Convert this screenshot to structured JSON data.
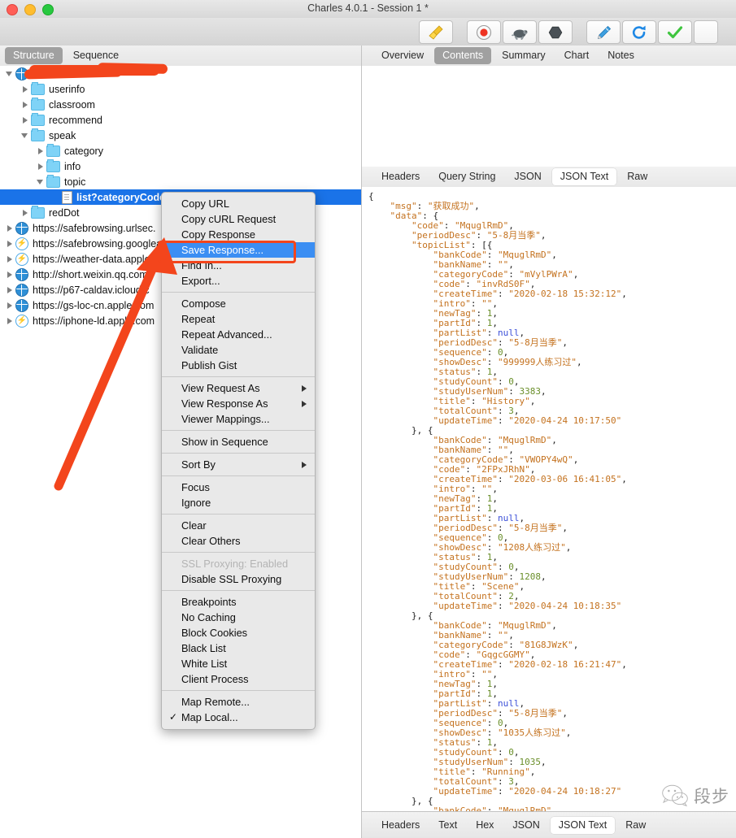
{
  "window": {
    "title": "Charles 4.0.1 - Session 1 *",
    "traffic_lights": [
      "close",
      "minimize",
      "zoom"
    ]
  },
  "toolbar": {
    "buttons": [
      {
        "name": "clear-session-button",
        "icon": "broom-icon"
      },
      {
        "name": "record-button",
        "icon": "record-icon"
      },
      {
        "name": "throttle-button",
        "icon": "turtle-icon"
      },
      {
        "name": "breakpoints-button",
        "icon": "stop-hexagon-icon"
      },
      {
        "name": "compose-button",
        "icon": "pen-icon"
      },
      {
        "name": "repeat-button",
        "icon": "refresh-icon"
      },
      {
        "name": "validate-button",
        "icon": "checkmark-icon"
      }
    ]
  },
  "left_panel": {
    "tabs": [
      {
        "label": "Structure",
        "selected": true
      },
      {
        "label": "Sequence",
        "selected": false
      }
    ],
    "tree": [
      {
        "label": "",
        "depth": 0,
        "icon": "globe-icon",
        "disclosure": "open",
        "redacted": true
      },
      {
        "label": "userinfo",
        "depth": 1,
        "icon": "folder-icon",
        "disclosure": "closed"
      },
      {
        "label": "classroom",
        "depth": 1,
        "icon": "folder-icon",
        "disclosure": "closed"
      },
      {
        "label": "recommend",
        "depth": 1,
        "icon": "folder-icon",
        "disclosure": "closed"
      },
      {
        "label": "speak",
        "depth": 1,
        "icon": "folder-icon",
        "disclosure": "open"
      },
      {
        "label": "category",
        "depth": 2,
        "icon": "folder-icon",
        "disclosure": "closed"
      },
      {
        "label": "info",
        "depth": 2,
        "icon": "folder-icon",
        "disclosure": "closed"
      },
      {
        "label": "topic",
        "depth": 2,
        "icon": "folder-icon",
        "disclosure": "open"
      },
      {
        "label": "list?categoryCode",
        "depth": 3,
        "icon": "document-icon",
        "disclosure": "none",
        "selected": true
      },
      {
        "label": "redDot",
        "depth": 1,
        "icon": "folder-icon",
        "disclosure": "closed"
      },
      {
        "label": "https://safebrowsing.urlsec.",
        "depth": 0,
        "icon": "globe-icon",
        "disclosure": "closed"
      },
      {
        "label": "https://safebrowsing.googlea",
        "depth": 0,
        "icon": "bolt-icon",
        "disclosure": "closed"
      },
      {
        "label": "https://weather-data.apple.c",
        "depth": 0,
        "icon": "bolt-icon",
        "disclosure": "closed"
      },
      {
        "label": "http://short.weixin.qq.com",
        "depth": 0,
        "icon": "globe-icon",
        "disclosure": "closed"
      },
      {
        "label": "https://p67-caldav.icloud.c",
        "depth": 0,
        "icon": "globe-icon",
        "disclosure": "closed"
      },
      {
        "label": "https://gs-loc-cn.apple.com",
        "depth": 0,
        "icon": "globe-icon",
        "disclosure": "closed"
      },
      {
        "label": "https://iphone-ld.apple.com",
        "depth": 0,
        "icon": "bolt-icon",
        "disclosure": "closed"
      }
    ]
  },
  "context_menu": {
    "highlighted_item": "Save Response...",
    "groups": [
      [
        {
          "label": "Copy URL"
        },
        {
          "label": "Copy cURL Request"
        },
        {
          "label": "Copy Response"
        },
        {
          "label": "Save Response...",
          "highlighted": true
        },
        {
          "label": "Find In..."
        },
        {
          "label": "Export..."
        }
      ],
      [
        {
          "label": "Compose"
        },
        {
          "label": "Repeat"
        },
        {
          "label": "Repeat Advanced..."
        },
        {
          "label": "Validate"
        },
        {
          "label": "Publish Gist"
        }
      ],
      [
        {
          "label": "View Request As",
          "submenu": true
        },
        {
          "label": "View Response As",
          "submenu": true
        },
        {
          "label": "Viewer Mappings..."
        }
      ],
      [
        {
          "label": "Show in Sequence"
        }
      ],
      [
        {
          "label": "Sort By",
          "submenu": true
        }
      ],
      [
        {
          "label": "Focus"
        },
        {
          "label": "Ignore"
        }
      ],
      [
        {
          "label": "Clear"
        },
        {
          "label": "Clear Others"
        }
      ],
      [
        {
          "label": "SSL Proxying: Enabled",
          "disabled": true
        },
        {
          "label": "Disable SSL Proxying"
        }
      ],
      [
        {
          "label": "Breakpoints"
        },
        {
          "label": "No Caching"
        },
        {
          "label": "Block Cookies"
        },
        {
          "label": "Black List"
        },
        {
          "label": "White List"
        },
        {
          "label": "Client Process"
        }
      ],
      [
        {
          "label": "Map Remote..."
        },
        {
          "label": "Map Local...",
          "checked": true
        }
      ]
    ]
  },
  "right_panel": {
    "tabs": [
      {
        "label": "Overview",
        "selected": false
      },
      {
        "label": "Contents",
        "selected": true
      },
      {
        "label": "Summary",
        "selected": false
      },
      {
        "label": "Chart",
        "selected": false
      },
      {
        "label": "Notes",
        "selected": false
      }
    ],
    "request_subtabs": [
      {
        "label": "Headers",
        "selected": false
      },
      {
        "label": "Query String",
        "selected": false
      },
      {
        "label": "JSON",
        "selected": false
      },
      {
        "label": "JSON Text",
        "selected": true
      },
      {
        "label": "Raw",
        "selected": false
      }
    ],
    "response_subtabs": [
      {
        "label": "Headers",
        "selected": false
      },
      {
        "label": "Text",
        "selected": false
      },
      {
        "label": "Hex",
        "selected": false
      },
      {
        "label": "JSON",
        "selected": false
      },
      {
        "label": "JSON Text",
        "selected": true
      },
      {
        "label": "Raw",
        "selected": false
      }
    ]
  },
  "json_response": {
    "msg": "获取成功",
    "data": {
      "code": "MquglRmD",
      "periodDesc": "5-8月当季",
      "topicList": [
        {
          "bankCode": "MquglRmD",
          "bankName": "",
          "categoryCode": "mVylPWrA",
          "code": "invRdS0F",
          "createTime": "2020-02-18 15:32:12",
          "intro": "",
          "newTag": 1,
          "partId": 1,
          "partList": null,
          "periodDesc": "5-8月当季",
          "sequence": 0,
          "showDesc": "999999人练习过",
          "status": 1,
          "studyCount": 0,
          "studyUserNum": 3383,
          "title": "History",
          "totalCount": 3,
          "updateTime": "2020-04-24 10:17:50"
        },
        {
          "bankCode": "MquglRmD",
          "bankName": "",
          "categoryCode": "VWOPY4wQ",
          "code": "2FPxJRhN",
          "createTime": "2020-03-06 16:41:05",
          "intro": "",
          "newTag": 1,
          "partId": 1,
          "partList": null,
          "periodDesc": "5-8月当季",
          "sequence": 0,
          "showDesc": "1208人练习过",
          "status": 1,
          "studyCount": 0,
          "studyUserNum": 1208,
          "title": "Scene",
          "totalCount": 2,
          "updateTime": "2020-04-24 10:18:35"
        },
        {
          "bankCode": "MquglRmD",
          "bankName": "",
          "categoryCode": "81G8JWzK",
          "code": "GqgcGGMY",
          "createTime": "2020-02-18 16:21:47",
          "intro": "",
          "newTag": 1,
          "partId": 1,
          "partList": null,
          "periodDesc": "5-8月当季",
          "sequence": 0,
          "showDesc": "1035人练习过",
          "status": 1,
          "studyCount": 0,
          "studyUserNum": 1035,
          "title": "Running",
          "totalCount": 3,
          "updateTime": "2020-04-24 10:18:27"
        },
        {
          "bankCode": "MquglRmD"
        }
      ]
    }
  },
  "watermark": {
    "text": "段步",
    "logo": "wechat-icon"
  },
  "colors": {
    "selection_blue": "#1a73e8",
    "menu_highlight": "#3b8ef3",
    "annotation_red": "#f3451c",
    "json_string": "#c4721f",
    "json_number": "#6a8f2a",
    "json_null": "#3b4fd8"
  }
}
